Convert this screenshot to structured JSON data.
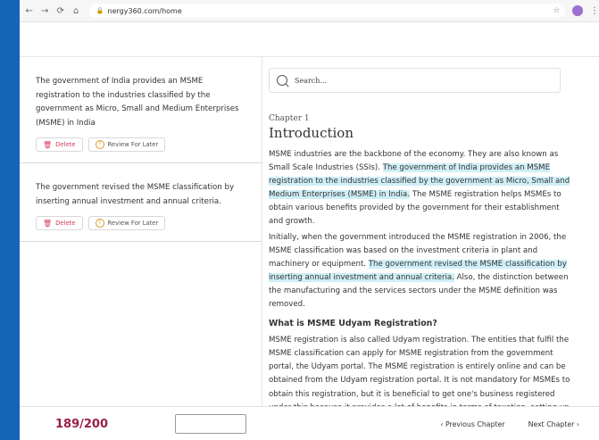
{
  "browser": {
    "url": "nergy360.com/home",
    "back": "←",
    "forward": "→",
    "reload": "⟳",
    "home": "⌂"
  },
  "notes": [
    {
      "text": "The government of India provides an MSME registration to the industries classified by the government as Micro, Small and Medium Enterprises (MSME) in India",
      "delete_label": "Delete",
      "review_label": "Review For Later"
    },
    {
      "text": "The government revised the MSME classification by inserting annual investment and annual criteria.",
      "delete_label": "Delete",
      "review_label": "Review For Later"
    }
  ],
  "search": {
    "placeholder": "Search..."
  },
  "chapter": {
    "number": "Chapter 1",
    "title": "Introduction",
    "p1_pre": "MSME industries are the backbone of the economy. They are also known as Small Scale Industries (SSIs). ",
    "p1_hl": "The government of India provides an MSME registration to the industries classified by the government as Micro, Small and Medium Enterprises (MSME) in India.",
    "p1_post": " The MSME registration helps MSMEs to obtain various benefits provided by the government for their establishment and growth.",
    "p2_pre": "Initially, when the government introduced the MSME registration in 2006, the MSME classification was based on the investment criteria in plant and machinery or equipment. ",
    "p2_hl": "The government revised the MSME classification by inserting annual investment and annual criteria.",
    "p2_post": " Also, the distinction between the manufacturing and the services sectors under the MSME definition was removed.",
    "subheading": "What is MSME Udyam Registration?",
    "p3": "MSME registration is also called Udyam registration. The entities that fulfil the MSME classification can apply for MSME registration from the government portal, the Udyam portal. The MSME registration is entirely online and can be obtained from the Udyam registration portal. It is not mandatory for MSMEs to obtain this registration, but it is beneficial to get one's business registered under this because it provides a lot of benefits in terms of taxation, setting up the business, credit facilities, loans etc."
  },
  "footer": {
    "counter": "189/200",
    "prev_label": "‹  Previous Chapter",
    "next_label": "Next Chapter  ›"
  }
}
